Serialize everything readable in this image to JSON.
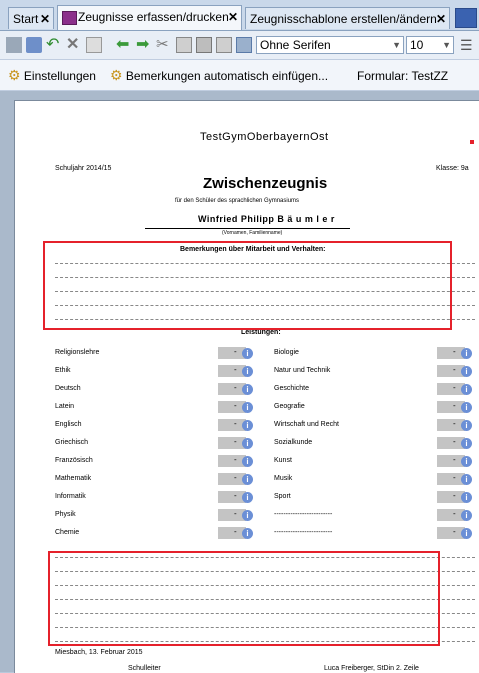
{
  "tabs": [
    {
      "label": "Start"
    },
    {
      "label": "Zeugnisse erfassen/drucken"
    },
    {
      "label": "Zeugnisschablone erstellen/ändern"
    }
  ],
  "toolbar": {
    "font_family": "Ohne Serifen",
    "font_size": "10"
  },
  "subtoolbar": {
    "settings_label": "Einstellungen",
    "remarks_label": "Bemerkungen automatisch einfügen...",
    "formular_label": "Formular: TestZZ"
  },
  "document": {
    "school": "TestGymOberbayernOst",
    "school_year": "Schuljahr 2014/15",
    "class": "Klasse: 9a",
    "title": "Zwischenzeugnis",
    "subtitle": "für den Schüler des sprachlichen Gymnasiums",
    "student_name": "Winfried Philipp  B ä u m l e r",
    "name_caption": "(Vornamen, Familienname)",
    "remarks_heading": "Bemerkungen über Mitarbeit und Verhalten:",
    "performance_heading": "Leistungen:",
    "grade_placeholder": "-",
    "subjects_left": [
      "Religionslehre",
      "Ethik",
      "Deutsch",
      "Latein",
      "Englisch",
      "Griechisch",
      "Französisch",
      "Mathematik",
      "Informatik",
      "Physik",
      "Chemie"
    ],
    "subjects_right": [
      "Biologie",
      "Natur und Technik",
      "Geschichte",
      "Geografie",
      "Wirtschaft und Recht",
      "Sozialkunde",
      "Kunst",
      "Musik",
      "Sport",
      "-------------------------",
      "-------------------------"
    ],
    "place_date": "Miesbach, 13. Februar 2015",
    "principal_label": "Schulleiter",
    "teacher_label": "Luca Freiberger, StDin 2. Zeile"
  }
}
